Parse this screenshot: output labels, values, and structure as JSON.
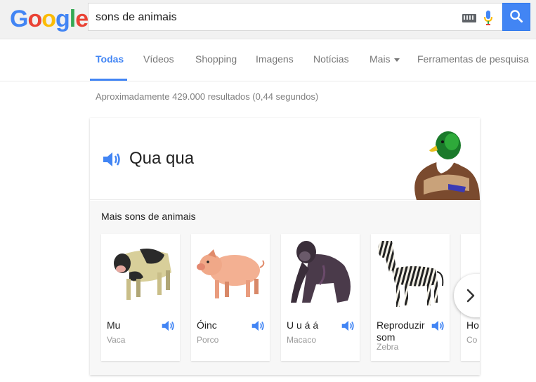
{
  "header": {
    "logo_letters": [
      {
        "ch": "G",
        "color": "#4285f4"
      },
      {
        "ch": "o",
        "color": "#ea4335"
      },
      {
        "ch": "o",
        "color": "#fbbc05"
      },
      {
        "ch": "g",
        "color": "#4285f4"
      },
      {
        "ch": "l",
        "color": "#34a853"
      },
      {
        "ch": "e",
        "color": "#ea4335"
      }
    ],
    "search_value": "sons de animais",
    "search_button_color": "#4285f4"
  },
  "tabs": [
    {
      "label": "Todas",
      "active": true
    },
    {
      "label": "Vídeos"
    },
    {
      "label": "Shopping"
    },
    {
      "label": "Imagens"
    },
    {
      "label": "Notícias"
    },
    {
      "label": "Mais"
    },
    {
      "label": "Ferramentas de pesquisa"
    }
  ],
  "result_stats": "Aproximadamente 429.000 resultados (0,44 segundos)",
  "sound_card": {
    "title": "Qua qua",
    "image_icon": "duck",
    "more_label": "Mais sons de animais",
    "animals": [
      {
        "name": "Mu",
        "sub": "Vaca",
        "icon": "cow"
      },
      {
        "name": "Óinc",
        "sub": "Porco",
        "icon": "pig"
      },
      {
        "name": "U u á á",
        "sub": "Macaco",
        "icon": "gorilla"
      },
      {
        "name": "Reproduzir som",
        "sub": "Zebra",
        "icon": "zebra"
      },
      {
        "name": "Ho",
        "sub": "Co",
        "icon": "partial"
      }
    ]
  },
  "accent_color": "#4285f4"
}
